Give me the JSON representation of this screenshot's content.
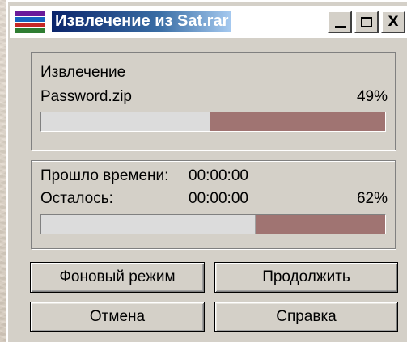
{
  "window": {
    "title": "Извлечение из Sat.rar",
    "controls": {
      "close_label": "X"
    }
  },
  "extract_group": {
    "heading": "Извлечение",
    "file_name": "Password.zip",
    "percent_label": "49%",
    "progress": 0.49
  },
  "time_group": {
    "elapsed_label": "Прошло времени:",
    "elapsed_value": "00:00:00",
    "remaining_label": "Осталось:",
    "remaining_value": "00:00:00",
    "percent_label": "62%",
    "progress": 0.62
  },
  "buttons": {
    "background": "Фоновый режим",
    "continue": "Продолжить",
    "cancel": "Отмена",
    "help": "Справка"
  },
  "colors": {
    "progress_remaining": "#a07472",
    "progress_done": "#dcdcdc",
    "title_bar": "#0a246a"
  },
  "icons": {
    "app_icon": "winrar-books-icon"
  }
}
